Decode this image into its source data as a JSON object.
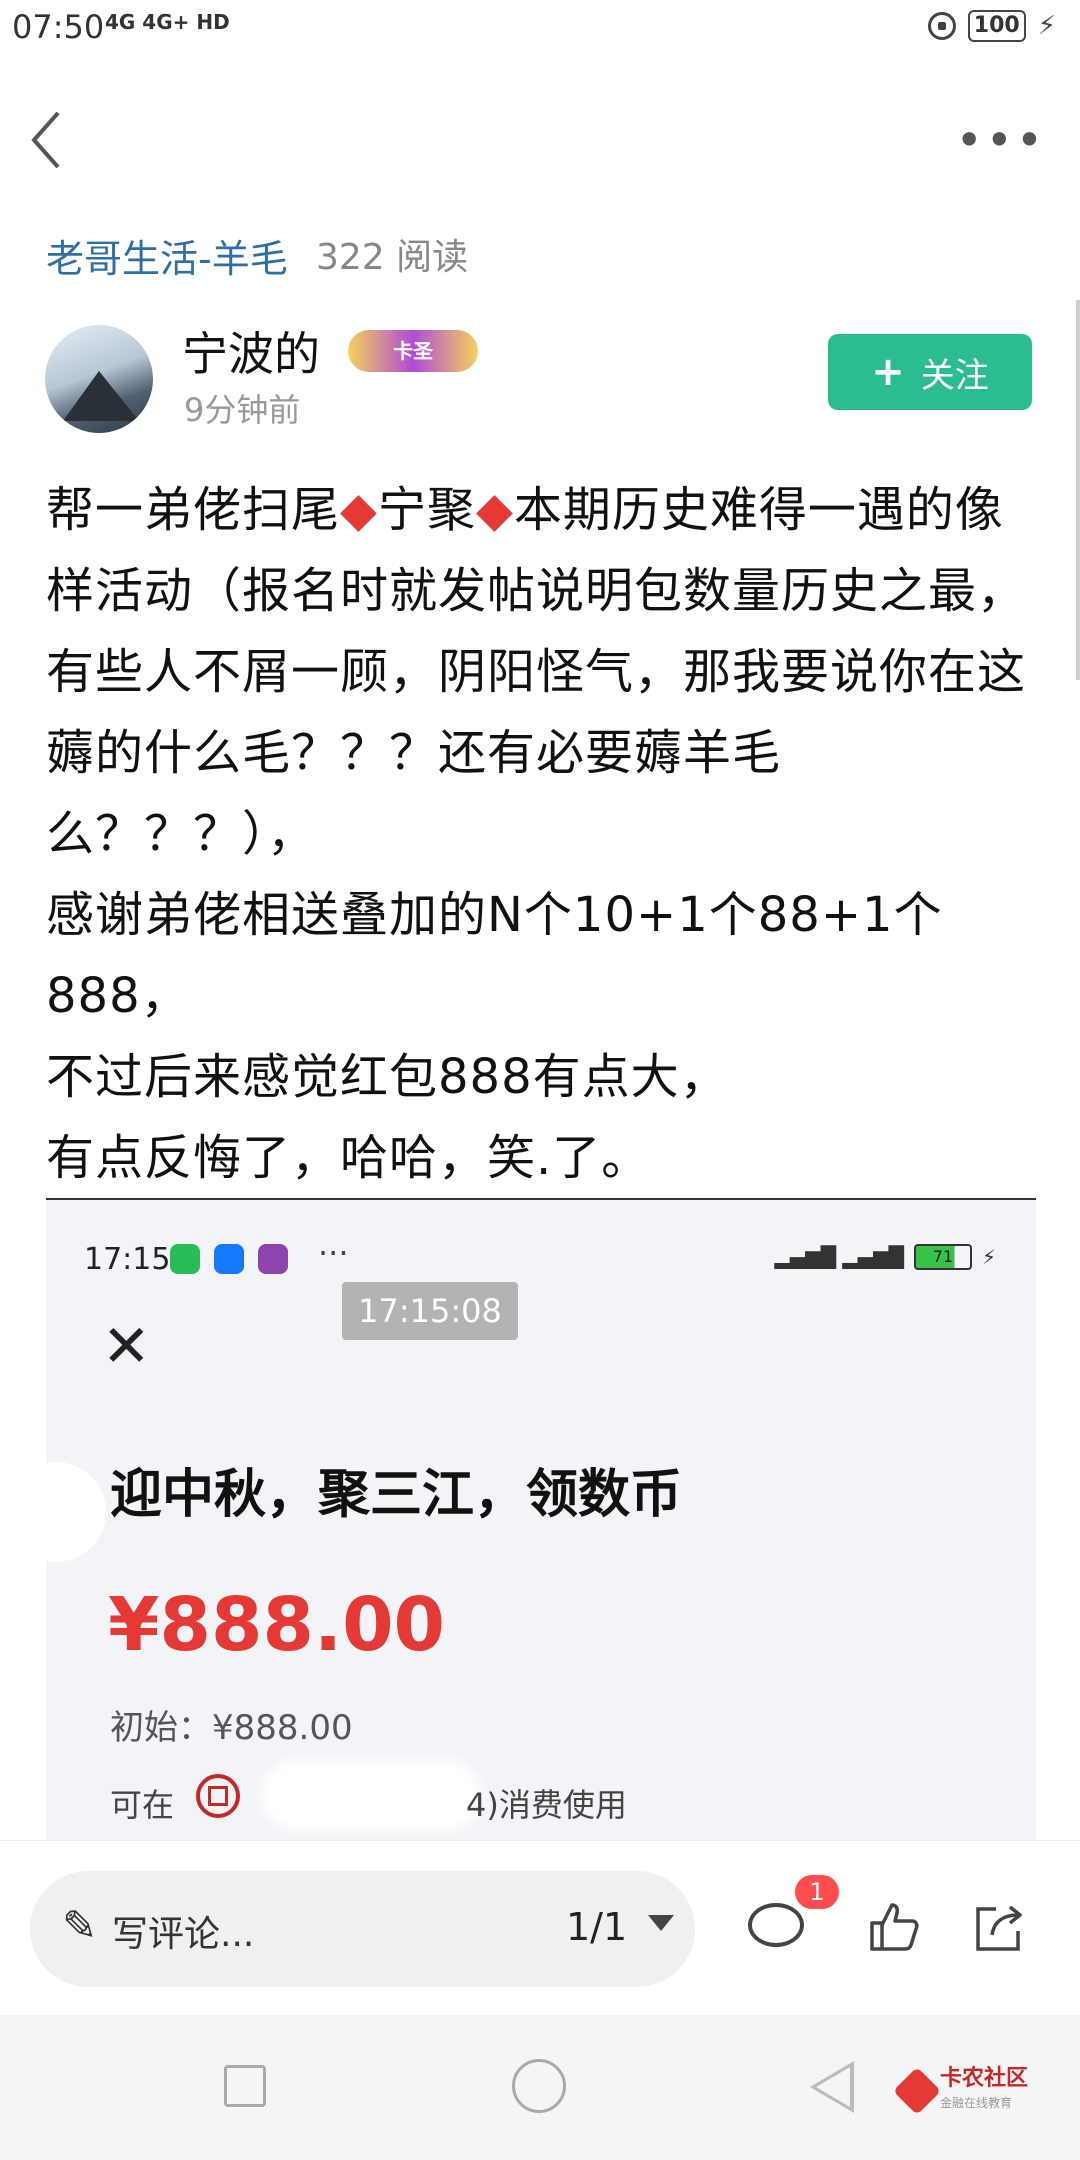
{
  "status_bar": {
    "time": "07:50",
    "signal_text": "4G 4G+ HD",
    "battery": "100"
  },
  "header": {
    "circle_name": "老哥生活-羊毛",
    "read_count": "322 阅读"
  },
  "author": {
    "name": "宁波的",
    "badge": "卡圣",
    "time": "9分钟前",
    "follow_label": "关注"
  },
  "post": {
    "paragraphs": [
      "帮一弟佬扫尾",
      "宁聚",
      "本期历史难得一遇的像样活动（报名时就发帖说明包数量历史之最，有些人不屑一顾，阴阳怪气，那我要说你在这薅的什么毛？？？还有必要薅羊毛么？？？），",
      "感谢弟佬相送叠加的N个10+1个88+1个888，",
      "不过后来感觉红包888有点大，",
      "有点反悔了，哈哈，笑.了。"
    ],
    "diamond": "◆"
  },
  "embedded": {
    "time": "17:15",
    "battery": "71",
    "timestamp": "17:15:08",
    "title": "迎中秋，聚三江，领数币",
    "amount": "¥888.00",
    "initial": "初始：¥888.00",
    "usage_prefix": "可在",
    "usage_suffix": "4)消费使用"
  },
  "comment_bar": {
    "placeholder": "写评论...",
    "page_indicator": "1/1",
    "comment_count": "1"
  },
  "watermark": {
    "title": "卡农社区",
    "subtitle": "金融在线教育"
  }
}
